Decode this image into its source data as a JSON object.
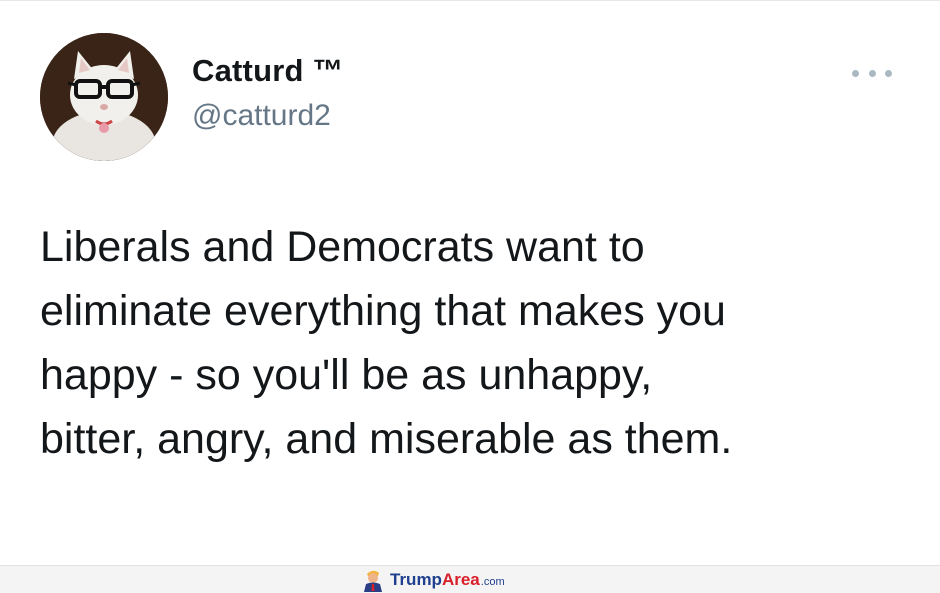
{
  "tweet": {
    "display_name": "Catturd ™",
    "handle": "@catturd2",
    "avatar_icon": "cat-with-glasses-avatar",
    "more_icon": "more-dots-icon",
    "text_lines": [
      "Liberals and Democrats want to",
      "eliminate everything that makes you",
      "happy - so you'll be as unhappy,",
      "bitter, angry, and miserable as them."
    ]
  },
  "watermark": {
    "brand_part1": "Trump",
    "brand_part2": "Area",
    "brand_tld": ".com",
    "colors": {
      "trump": "#1f3f8f",
      "area": "#d8202a"
    }
  }
}
